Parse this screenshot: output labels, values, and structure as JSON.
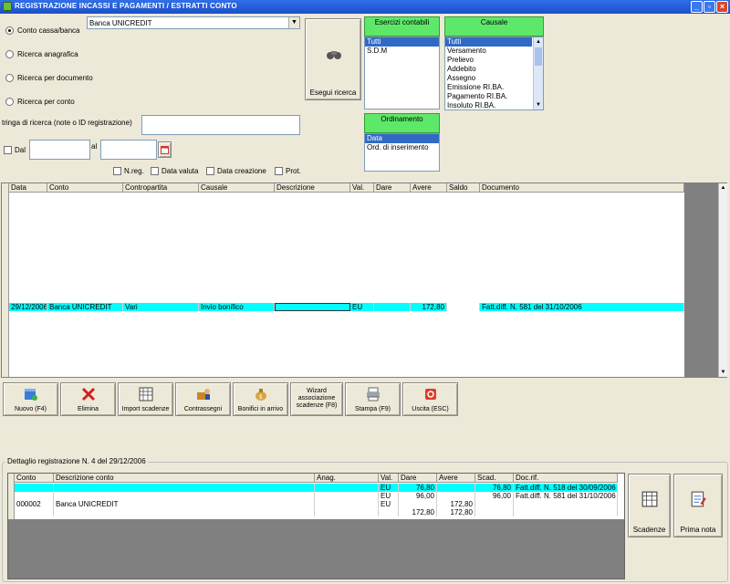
{
  "window": {
    "title": "REGISTRAZIONE INCASSI E PAGAMENTI / ESTRATTI CONTO"
  },
  "search": {
    "radios": [
      {
        "label": "Conto cassa/banca",
        "checked": true
      },
      {
        "label": "Ricerca anagrafica",
        "checked": false
      },
      {
        "label": "Ricerca per documento",
        "checked": false
      },
      {
        "label": "Ricerca per conto",
        "checked": false
      }
    ],
    "account_select": "Banca UNICREDIT",
    "search_button": "Esegui ricerca",
    "search_string_label": "tringa di ricerca (note o ID registrazione)",
    "search_string_value": "",
    "dal_label": "Dal",
    "al_label": "al",
    "dal_value": "",
    "al_value": "",
    "checkboxes": [
      "N.reg.",
      "Data valuta",
      "Data creazione",
      "Prot."
    ]
  },
  "esercizi": {
    "header": "Esercizi contabili",
    "items": [
      "Tutti",
      "S.D.M"
    ],
    "selected": 0
  },
  "causale": {
    "header": "Causale",
    "items": [
      "Tutti",
      "Versamento",
      "Prelievo",
      "Addebito",
      "Assegno",
      "Emissione RI.BA.",
      "Pagamento RI.BA.",
      "Insoluto RI.BA."
    ],
    "selected": 0
  },
  "ordinamento": {
    "header": "Ordinamento",
    "items": [
      "Data",
      "Ord. di inserimento"
    ],
    "selected": 0
  },
  "main_grid": {
    "columns": [
      "Data",
      "Conto",
      "Contropartita",
      "Causale",
      "Descrizione",
      "Val.",
      "Dare",
      "Avere",
      "Saldo",
      "Documento"
    ],
    "rows": [
      {
        "data": "29/12/2006",
        "conto": "Banca UNICREDIT",
        "contropartita": "Vari",
        "causale": "Invio bonifico",
        "descrizione": "",
        "val": "EU",
        "dare": "",
        "avere": "172,80",
        "saldo": "",
        "documento": "Fatt.diff. N. 581 del 31/10/2006"
      }
    ]
  },
  "toolbar": {
    "nuovo": "Nuovo (F4)",
    "elimina": "Elimina",
    "import": "Import scadenze",
    "contrassegni": "Contrassegni",
    "bonifici": "Bonifici in arrivo",
    "wizard": "Wizard associazione scadenze (F8)",
    "stampa": "Stampa (F9)",
    "uscita": "Uscita (ESC)"
  },
  "detail": {
    "title": "Dettaglio registrazione N. 4 del 29/12/2006",
    "columns": [
      "Conto",
      "Descrizione conto",
      "Anag.",
      "Val.",
      "Dare",
      "Avere",
      "Scad.",
      "Doc.rif."
    ],
    "rows": [
      {
        "conto": "",
        "descr": "",
        "anag": "",
        "val": "EU",
        "dare": "76,80",
        "avere": "",
        "scad": "76,80",
        "doc": "Fatt.diff. N. 518 del 30/09/2006",
        "hl": true
      },
      {
        "conto": "",
        "descr": "",
        "anag": "",
        "val": "EU",
        "dare": "96,00",
        "avere": "",
        "scad": "96,00",
        "doc": "Fatt.diff. N. 581 del 31/10/2006",
        "hl": false
      },
      {
        "conto": "000002",
        "descr": "Banca UNICREDIT",
        "anag": "",
        "val": "EU",
        "dare": "",
        "avere": "172,80",
        "scad": "",
        "doc": "",
        "hl": false
      },
      {
        "conto": "",
        "descr": "",
        "anag": "",
        "val": "",
        "dare": "172,80",
        "avere": "172,80",
        "scad": "",
        "doc": "",
        "hl": false
      }
    ],
    "scadenze_button": "Scadenze",
    "primanota_button": "Prima nota"
  }
}
